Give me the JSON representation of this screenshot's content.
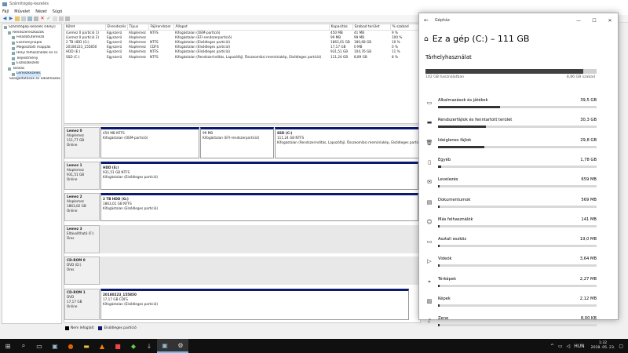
{
  "window": {
    "title": "Számítógép-kezelés"
  },
  "menu": [
    "Fájl",
    "Művelet",
    "Nézet",
    "Súgó"
  ],
  "tree": [
    {
      "label": "Számítógép-kezelés (Helyi)",
      "indent": 0
    },
    {
      "label": "Rendszereszközök",
      "indent": 1
    },
    {
      "label": "Feladatütemező",
      "indent": 2
    },
    {
      "label": "Eseménynapló",
      "indent": 2
    },
    {
      "label": "Megosztott mappák",
      "indent": 2
    },
    {
      "label": "Helyi felhasználók és cs",
      "indent": 2
    },
    {
      "label": "Teljesítmény",
      "indent": 2
    },
    {
      "label": "Eszközkezelő",
      "indent": 2
    },
    {
      "label": "Tárolás",
      "indent": 1
    },
    {
      "label": "Lemezkezelés",
      "indent": 2,
      "selected": true
    },
    {
      "label": "Szolgáltatások és alkalmazások",
      "indent": 1
    }
  ],
  "volume_list": {
    "headers": [
      "Kötet",
      "Elrendezés",
      "Típus",
      "Fájlrendszer",
      "Állapot",
      "Kapacitás",
      "Szabad terület",
      "% szabad"
    ],
    "rows": [
      [
        "(Lemez 0 partíció 1)",
        "Egyszerű",
        "Alaplemez",
        "NTFS",
        "Kifogástalan (OEM-partíció)",
        "450 MB",
        "41 MB",
        "9 %"
      ],
      [
        "(Lemez 0 partíció 2)",
        "Egyszerű",
        "Alaplemez",
        "",
        "Kifogástalan (EFI-rendszerpartíció)",
        "99 MB",
        "99 MB",
        "100 %"
      ],
      [
        "2 TB HDD (G:)",
        "Egyszerű",
        "Alaplemez",
        "NTFS",
        "Kifogástalan (Elsődleges partíció)",
        "1863,01 GB",
        "180,68 GB",
        "10 %"
      ],
      [
        "20180223_155850",
        "Egyszerű",
        "Alaplemez",
        "CDFS",
        "Kifogástalan (Elsődleges partíció)",
        "17,17 GB",
        "0 MB",
        "0 %"
      ],
      [
        "HDD (E:)",
        "Egyszerű",
        "Alaplemez",
        "NTFS",
        "Kifogástalan (Elsődleges partíció)",
        "931,51 GB",
        "104,76 GB",
        "11 %"
      ],
      [
        "SSD (C:)",
        "Egyszerű",
        "Alaplemez",
        "NTFS",
        "Kifogástalan (Rendszerindítás, Lapozófájl, Összeomlási memóriakép, Elsődleges partíció)",
        "111,24 GB",
        "8,89 GB",
        "8 %"
      ]
    ]
  },
  "disks": [
    {
      "name": "Lemez 0",
      "type": "Alaplemez",
      "size": "111,77 GB",
      "status": "Online",
      "partitions": [
        {
          "title": "",
          "line1": "450 MB NTFS",
          "line2": "Kifogástalan (OEM-partíció)"
        },
        {
          "title": "",
          "line1": "99 MB",
          "line2": "Kifogástalan (EFI-rendszerpartíció)"
        },
        {
          "title": "SSD (C:)",
          "line1": "111,24 GB NTFS",
          "line2": "Kifogástalan (Rendszerindítás, Lapozófájl, Összeomlási memóriakép, Elsődleges partíció)"
        }
      ]
    },
    {
      "name": "Lemez 1",
      "type": "Alaplemez",
      "size": "931,51 GB",
      "status": "Online",
      "partitions": [
        {
          "title": "HDD (E:)",
          "line1": "931,51 GB NTFS",
          "line2": "Kifogástalan (Elsődleges partíció)"
        }
      ]
    },
    {
      "name": "Lemez 2",
      "type": "Alaplemez",
      "size": "1863,02 GB",
      "status": "Online",
      "partitions": [
        {
          "title": "2 TB HDD (G:)",
          "line1": "1863,01 GB NTFS",
          "line2": "Kifogástalan (Elsődleges partíció)"
        }
      ]
    },
    {
      "name": "Lemez 3",
      "type": "Eltávolítható (F:)",
      "size": "",
      "status": "Üres",
      "partitions": []
    },
    {
      "name": "CD-ROM 0",
      "type": "DVD (D:)",
      "size": "",
      "status": "Üres",
      "partitions": []
    },
    {
      "name": "CD-ROM 1",
      "type": "DVD",
      "size": "17,17 GB",
      "status": "Online",
      "partitions": [
        {
          "title": "20180223_155850",
          "line1": "17,17 GB CDFS",
          "line2": "Kifogástalan (Elsődleges partíció)"
        }
      ]
    }
  ],
  "legend": {
    "unallocated": "Nem lefoglalt",
    "primary": "Elsődleges partíció",
    "unallocated_color": "#000000",
    "primary_color": "#0a1a6f"
  },
  "settings": {
    "app": "Gépház",
    "title": "Ez a gép (C:) – 111 GB",
    "subtitle": "Tárhelyhasználat",
    "used_label": "102 GB használatban",
    "free_label": "8,86 GB szabad",
    "used_fraction": 0.92,
    "categories": [
      {
        "name": "Alkalmazások és játékok",
        "size": "39,5 GB",
        "fraction": 0.39,
        "icon": "apps-icon"
      },
      {
        "name": "Rendszerfájlok és fenntartott terület",
        "size": "30,3 GB",
        "fraction": 0.3,
        "icon": "system-icon"
      },
      {
        "name": "Ideiglenes fájlok",
        "size": "29,8 GB",
        "fraction": 0.29,
        "icon": "trash-icon"
      },
      {
        "name": "Egyéb",
        "size": "1,78 GB",
        "fraction": 0.02,
        "icon": "other-icon"
      },
      {
        "name": "Levelezés",
        "size": "659 MB",
        "fraction": 0.0,
        "icon": "mail-icon"
      },
      {
        "name": "Dokumentumok",
        "size": "569 MB",
        "fraction": 0.0,
        "icon": "documents-icon"
      },
      {
        "name": "Más felhasználók",
        "size": "141 MB",
        "fraction": 0.0,
        "icon": "users-icon"
      },
      {
        "name": "Asztali eszköz",
        "size": "19,0 MB",
        "fraction": 0.0,
        "icon": "desktop-icon"
      },
      {
        "name": "Videók",
        "size": "3,64 MB",
        "fraction": 0.0,
        "icon": "video-icon"
      },
      {
        "name": "Térképek",
        "size": "2,27 MB",
        "fraction": 0.0,
        "icon": "map-icon"
      },
      {
        "name": "Képek",
        "size": "2,12 MB",
        "fraction": 0.0,
        "icon": "pictures-icon"
      },
      {
        "name": "Zene",
        "size": "8,00 KB",
        "fraction": 0.0,
        "icon": "music-icon"
      }
    ]
  },
  "taskbar": {
    "time": "1:32",
    "date": "2018. 05. 23.",
    "lang": "HUN"
  }
}
